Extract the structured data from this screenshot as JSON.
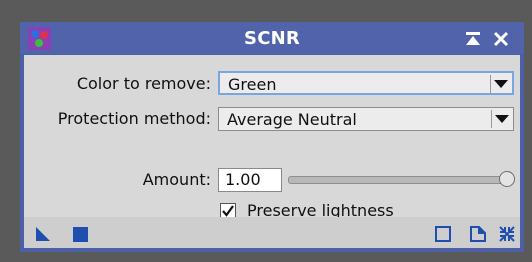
{
  "window": {
    "title": "SCNR"
  },
  "titlebar_buttons": [
    "shade-icon",
    "close-icon"
  ],
  "form": {
    "color_to_remove": {
      "label": "Color to remove:",
      "value": "Green"
    },
    "protection_method": {
      "label": "Protection method:",
      "value": "Average Neutral"
    },
    "amount": {
      "label": "Amount:",
      "value": "1.00",
      "slider_fraction": 1.0
    },
    "preserve_lightness": {
      "label": "Preserve lightness",
      "checked": true
    }
  },
  "bottom_bar": {
    "left_icons": [
      "new-instance-icon",
      "apply-global-icon"
    ],
    "right_icons": [
      "preview-icon",
      "browse-documentation-icon",
      "reset-icon"
    ]
  },
  "colors": {
    "titlebar": "#5163ab",
    "panel": "#d8d8d8",
    "icon_blue": "#1f4fae",
    "focus_border": "#79a6e0"
  }
}
